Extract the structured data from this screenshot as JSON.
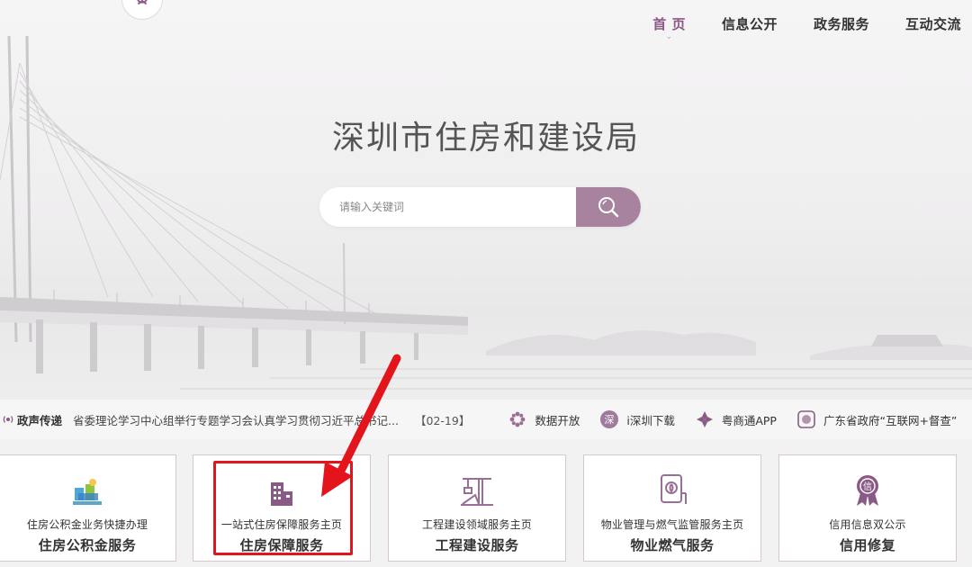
{
  "nav": {
    "items": [
      {
        "label": "首 页",
        "active": true
      },
      {
        "label": "信息公开",
        "active": false
      },
      {
        "label": "政务服务",
        "active": false
      },
      {
        "label": "互动交流",
        "active": false
      }
    ]
  },
  "hero": {
    "title": "深圳市住房和建设局"
  },
  "search": {
    "placeholder": "请输入关键词"
  },
  "ticker": {
    "label": "政声传递",
    "news": "省委理论学习中心组举行专题学习会认真学习贯彻习近平总书记...",
    "date": "【02-19】",
    "links": [
      {
        "label": "数据开放",
        "icon": "data-flower-icon"
      },
      {
        "label": "i深圳下载",
        "icon": "i-shenzhen-icon"
      },
      {
        "label": "粤商通APP",
        "icon": "yueshangtong-icon"
      },
      {
        "label": "广东省政府“互联网+督查”",
        "icon": "supervision-icon"
      }
    ]
  },
  "cards": [
    {
      "sub": "住房公积金业务快捷办理",
      "main": "住房公积金服务",
      "icon": "housing-fund-icon"
    },
    {
      "sub": "一站式住房保障服务主页",
      "main": "住房保障服务",
      "icon": "building-icon"
    },
    {
      "sub": "工程建设领域服务主页",
      "main": "工程建设服务",
      "icon": "crane-icon"
    },
    {
      "sub": "物业管理与燃气监管服务主页",
      "main": "物业燃气服务",
      "icon": "gas-meter-icon"
    },
    {
      "sub": "信用信息双公示",
      "main": "信用修复",
      "icon": "credit-medal-icon"
    }
  ],
  "colors": {
    "accent": "#a7839f",
    "nav_active": "#8a5a86",
    "card_border": "#d7c7d3",
    "highlight_red": "#e3141b"
  }
}
